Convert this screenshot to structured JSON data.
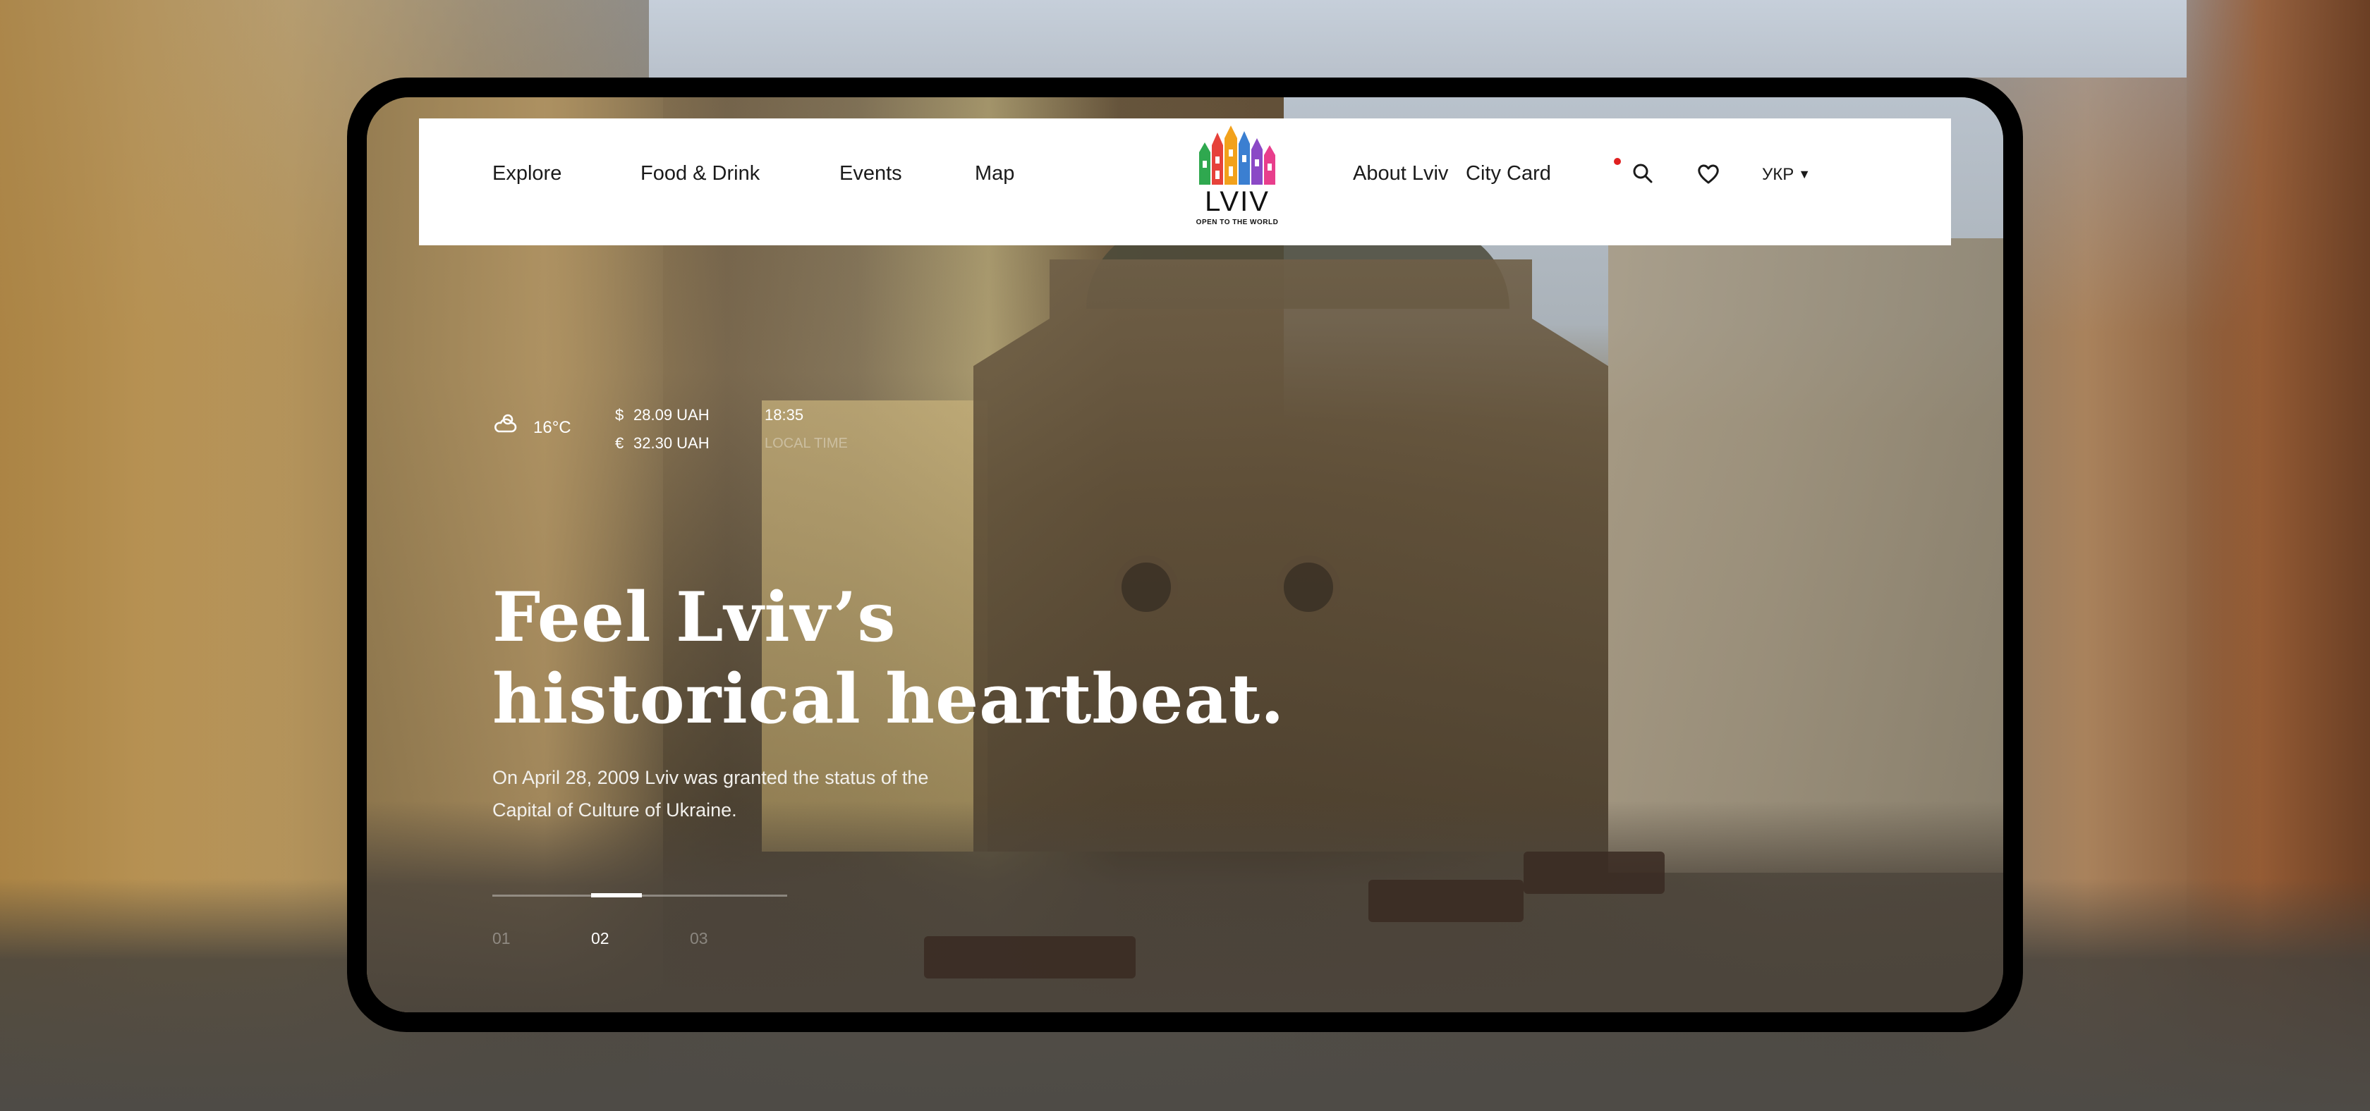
{
  "nav": {
    "left_items": [
      {
        "label": "Explore"
      },
      {
        "label": "Food & Drink"
      },
      {
        "label": "Events"
      },
      {
        "label": "Map"
      }
    ],
    "right_items": [
      {
        "label": "About Lviv"
      },
      {
        "label": "City Card",
        "notification": true
      }
    ],
    "search_icon": "search-icon",
    "favorites_icon": "heart-icon",
    "language": "УКР",
    "language_caret_icon": "caret-down-icon"
  },
  "logo": {
    "wordmark": "LVIV",
    "tagline": "OPEN TO THE WORLD",
    "colors": [
      "#2fa84f",
      "#e6423a",
      "#f2a11b",
      "#3b7fd1",
      "#8b49c6",
      "#e83e8c"
    ]
  },
  "info": {
    "weather_icon": "cloud-sun-icon",
    "temperature": "16°C",
    "usd_symbol": "$",
    "usd_rate": "28.09 UAH",
    "eur_symbol": "€",
    "eur_rate": "32.30 UAH",
    "time": "18:35",
    "time_label": "LOCAL TIME"
  },
  "hero": {
    "title_line1": "Feel Lviv’s",
    "title_line2": "historical heartbeat.",
    "description": "On April 28, 2009 Lviv was granted the status of the Capital of Culture of Ukraine."
  },
  "slider": {
    "slides": [
      "01",
      "02",
      "03"
    ],
    "active_index": 1,
    "total": 3
  },
  "colors": {
    "accent_red": "#e02020",
    "nav_background": "#ffffff",
    "frame": "#000000"
  }
}
